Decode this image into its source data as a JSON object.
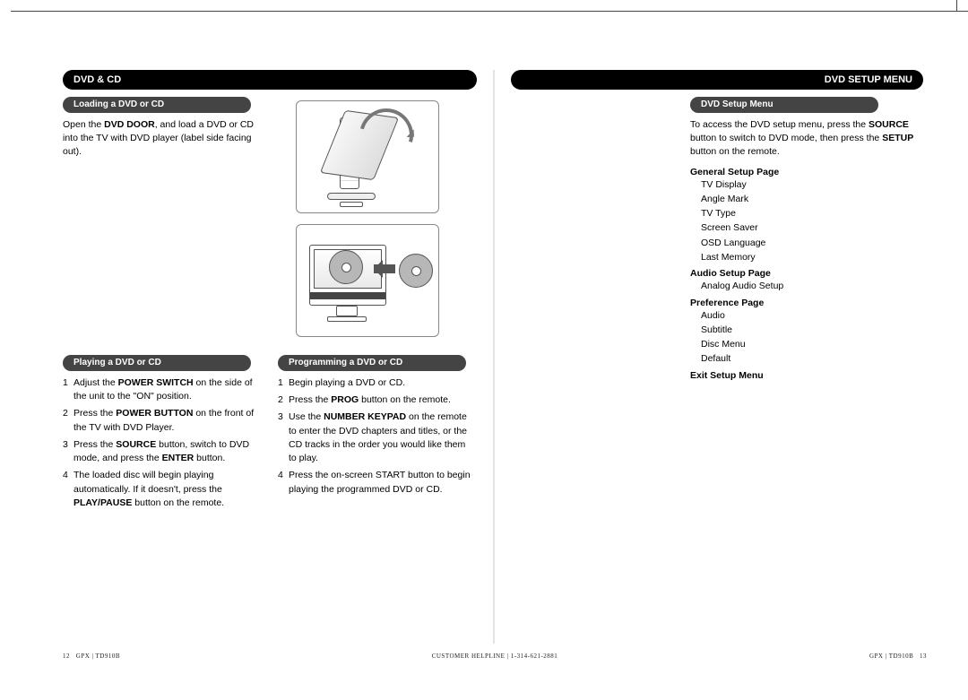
{
  "header": {
    "left_title": "DVD & CD",
    "right_title": "DVD SETUP MENU"
  },
  "left": {
    "loading": {
      "pill": "Loading a DVD or CD",
      "para_1": "Open the ",
      "para_bold": "DVD DOOR",
      "para_2": ", and load a DVD or CD into the TV with DVD player (label side facing out)."
    },
    "playing": {
      "pill": "Playing a DVD or CD",
      "steps": [
        {
          "n": "1",
          "pre": "Adjust the ",
          "b": "POWER SWITCH",
          "post": " on the side of the unit to the \"ON\" position."
        },
        {
          "n": "2",
          "pre": "Press the ",
          "b": "POWER BUTTON",
          "post": " on the front of the TV with DVD Player."
        },
        {
          "n": "3",
          "pre": "Press the ",
          "b": "SOURCE",
          "mid": " button, switch to DVD mode, and press the ",
          "b2": "ENTER",
          "post": " button."
        },
        {
          "n": "4",
          "pre": "The loaded disc will begin playing automatically. If it doesn't, press the ",
          "b": "PLAY/PAUSE",
          "post": " button on the remote."
        }
      ]
    },
    "programming": {
      "pill": "Programming a DVD or CD",
      "steps": [
        {
          "n": "1",
          "pre": "Begin playing a DVD or CD.",
          "b": "",
          "post": ""
        },
        {
          "n": "2",
          "pre": "Press the ",
          "b": "PROG",
          "post": " button on the remote."
        },
        {
          "n": "3",
          "pre": "Use the ",
          "b": "NUMBER KEYPAD",
          "post": " on the remote to enter the DVD chapters and titles, or the CD tracks in the order you would like them to play."
        },
        {
          "n": "4",
          "pre": "Press the on-screen START button to begin playing the programmed DVD or CD.",
          "b": "",
          "post": ""
        }
      ]
    }
  },
  "right": {
    "pill": "DVD Setup Menu",
    "intro_1": "To access the DVD setup menu, press the ",
    "intro_b1": "SOURCE",
    "intro_2": " button to switch to DVD mode, then press the ",
    "intro_b2": "SETUP",
    "intro_3": " button on the remote.",
    "groups": [
      {
        "title": "General Setup Page",
        "items": [
          "TV Display",
          "Angle Mark",
          "TV Type",
          "Screen Saver",
          "OSD Language",
          "Last Memory"
        ]
      },
      {
        "title": "Audio Setup Page",
        "items": [
          "Analog Audio Setup"
        ]
      },
      {
        "title": "Preference Page",
        "items": [
          "Audio",
          "Subtitle",
          "Disc Menu",
          "Default"
        ]
      },
      {
        "title": "Exit Setup Menu",
        "items": []
      }
    ]
  },
  "footer": {
    "left_num": "12",
    "left_label": "GPX | TD910B",
    "center": "CUSTOMER HELPLINE | 1-314-621-2881",
    "right_label": "GPX | TD910B",
    "right_num": "13"
  }
}
